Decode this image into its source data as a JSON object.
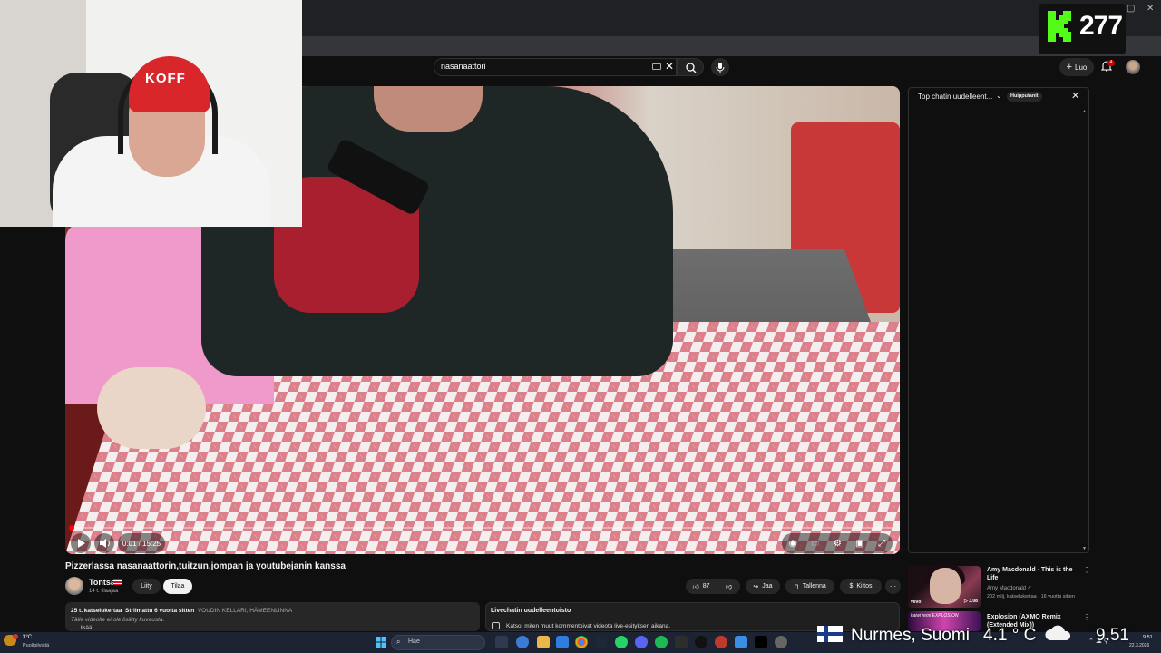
{
  "browser": {
    "window_controls": [
      "—",
      "▢",
      "✕"
    ]
  },
  "counter": {
    "value": "277",
    "logo_icon": "kick-logo-icon",
    "logo_color": "#53fc18"
  },
  "header": {
    "search_value": "nasanaattori",
    "create_label": "Luo",
    "notifications_count": "4"
  },
  "video": {
    "time": "0:01 / 15:25",
    "progress_fraction": 0.001,
    "cap_text": "KOFF"
  },
  "meta": {
    "title": "Pizzerlassa nasanaattorin,tuitzun,jompan ja youtubejanin kanssa",
    "channel": "Tontsa",
    "subscribers": "14 t. tilaajaa",
    "join_label": "Liity",
    "subscribe_label": "Tilaa",
    "likes": "87",
    "share_label": "Jaa",
    "save_label": "Tallenna",
    "thanks_label": "Kiitos",
    "more_label": "⋯"
  },
  "description": {
    "views": "25 t. katselukertaa",
    "streamed": "Striimattu 6 vuotta sitten",
    "location": "VOUDIN KELLARI, HÄMEENLINNA",
    "no_desc": "Tälle videolle ei ole lisätty kuvausta.",
    "more": "...lisää"
  },
  "replay": {
    "title": "Livechatin uudelleentoisto",
    "text": "Katso, miten muut kommentoivat videota live-esityksen aikana."
  },
  "chat": {
    "header": "Top chatin uudelleent...",
    "badge": "Huippufanit",
    "more": "⋮",
    "close": "✕"
  },
  "recommendations": [
    {
      "title": "Amy Macdonald - This is the Life",
      "channel": "Amy Macdonald ✓",
      "meta": "202 milj. katselukertaa · 16 vuotta sitten",
      "thumb_label": "vevo",
      "thumb_views": "▷ 3.08"
    },
    {
      "title": "Explosion (AXMO Remix (Extended Mix))",
      "thumb_label": "kaiwi remi EXPLOSION"
    }
  ],
  "overlay": {
    "location": "Nurmes, Suomi",
    "temperature": "4.1 ° C",
    "time": "9.51"
  },
  "taskbar": {
    "temp": "3°C",
    "weather_text": "Puolipilvistä",
    "search_placeholder": "Hae",
    "clock": "9.51",
    "date": "22.3.2026"
  }
}
